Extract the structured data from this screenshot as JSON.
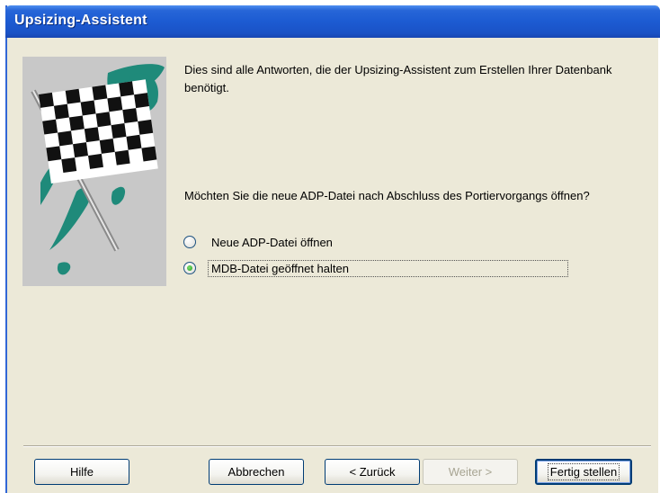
{
  "window": {
    "title": "Upsizing-Assistent"
  },
  "intro_text": "Dies sind alle Antworten, die der Upsizing-Assistent zum Erstellen Ihrer Datenbank benötigt.",
  "question": "Möchten Sie die neue ADP-Datei nach Abschluss des Portiervorgangs öffnen?",
  "options": [
    {
      "label": "Neue ADP-Datei öffnen",
      "selected": false
    },
    {
      "label": "MDB-Datei geöffnet halten",
      "selected": true
    }
  ],
  "buttons": {
    "help": "Hilfe",
    "cancel": "Abbrechen",
    "back": "< Zurück",
    "next": "Weiter >",
    "finish": "Fertig stellen"
  },
  "picture": {
    "icon": "checkered-flag-icon",
    "accent": "#1f8a7a"
  }
}
